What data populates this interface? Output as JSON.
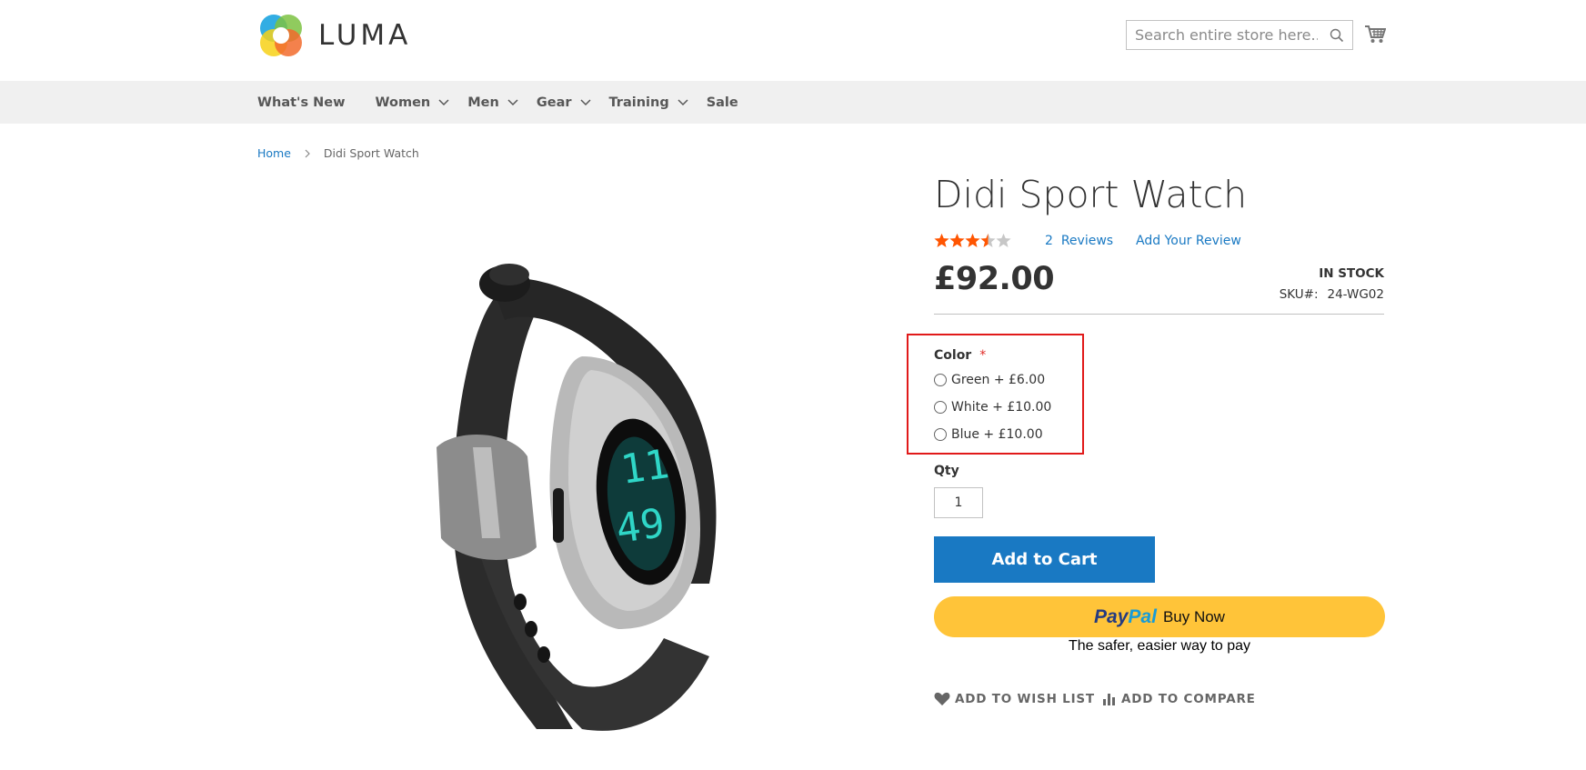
{
  "header": {
    "logo_text": "LUMA",
    "search": {
      "placeholder": "Search entire store here..."
    }
  },
  "nav": {
    "items": [
      {
        "label": "What's New",
        "has_dropdown": false
      },
      {
        "label": "Women",
        "has_dropdown": true
      },
      {
        "label": "Men",
        "has_dropdown": true
      },
      {
        "label": "Gear",
        "has_dropdown": true
      },
      {
        "label": "Training",
        "has_dropdown": true
      },
      {
        "label": "Sale",
        "has_dropdown": false
      }
    ]
  },
  "breadcrumb": {
    "home": "Home",
    "current": "Didi Sport Watch"
  },
  "product": {
    "title": "Didi Sport Watch",
    "rating": {
      "score": 3.5,
      "max": 5
    },
    "reviews_count": "2",
    "reviews_label": "Reviews",
    "add_review_label": "Add Your Review",
    "price": "£92.00",
    "stock": "IN STOCK",
    "sku_label": "SKU#:",
    "sku": "24-WG02",
    "color_label": "Color",
    "required_mark": "*",
    "color_options": [
      {
        "label": "Green + £6.00"
      },
      {
        "label": "White + £10.00"
      },
      {
        "label": "Blue + £10.00"
      }
    ],
    "qty_label": "Qty",
    "qty_value": "1",
    "add_to_cart_label": "Add to Cart",
    "paypal": {
      "logo_pay": "Pay",
      "logo_pal": "Pal",
      "buy_now": "Buy Now",
      "tagline": "The safer, easier way to pay"
    },
    "wishlist_label": "ADD TO WISH LIST",
    "compare_label": "ADD TO COMPARE"
  },
  "colors": {
    "accent": "#1979c3",
    "star": "#ff5501",
    "star_empty": "#c7c7c7",
    "paypal_yellow": "#ffc439",
    "highlight": "#e11a1a",
    "nav_bg": "#f0f0f0"
  }
}
